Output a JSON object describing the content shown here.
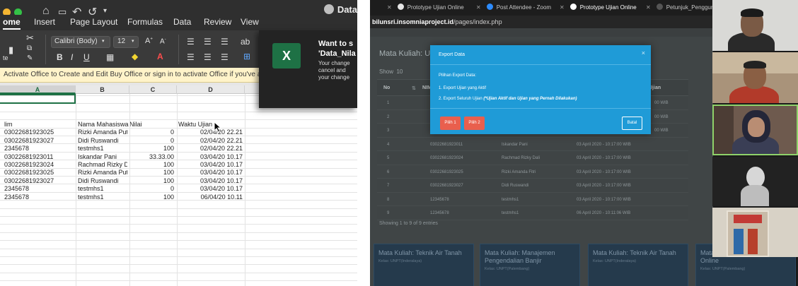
{
  "excel": {
    "document_name": "Data",
    "ribbon_tabs": [
      "ome",
      "Insert",
      "Page Layout",
      "Formulas",
      "Data",
      "Review",
      "View"
    ],
    "active_tab": "ome",
    "font_name": "Calibri (Body)",
    "font_size": "12",
    "notice": "Activate Office to Create and Edit   Buy Office or sign in to activate Office if you've already",
    "columns": [
      "A",
      "B",
      "C",
      "D"
    ],
    "header_row": {
      "a": "lim",
      "b": "Nama Mahasiswa",
      "c": "Nilai",
      "d": "Waktu Ujian"
    },
    "rows": [
      {
        "a": "03022681923025",
        "b": "Rizki Amanda Putri",
        "c": "0",
        "d": "02/04/20 22.21"
      },
      {
        "a": "03022681923027",
        "b": "Didi Ruswandi",
        "c": "0",
        "d": "02/04/20 22.21"
      },
      {
        "a": "2345678",
        "b": "testmhs1",
        "c": "100",
        "d": "02/04/20 22.21"
      },
      {
        "a": "03022681923011",
        "b": "Iskandar Pani",
        "c": "33.33.00",
        "d": "03/04/20 10.17"
      },
      {
        "a": "03022681923024",
        "b": "Rachmad Rizky Dali",
        "c": "100",
        "d": "03/04/20 10.17"
      },
      {
        "a": "03022681923025",
        "b": "Rizki Amanda Putri",
        "c": "100",
        "d": "03/04/20 10.17"
      },
      {
        "a": "03022681923027",
        "b": "Didi Ruswandi",
        "c": "100",
        "d": "03/04/20 10.17"
      },
      {
        "a": "2345678",
        "b": "testmhs1",
        "c": "0",
        "d": "03/04/20 10.17"
      },
      {
        "a": "2345678",
        "b": "testmhs1",
        "c": "100",
        "d": "06/04/20 10.11"
      }
    ],
    "dialog": {
      "title_line1": "Want to s",
      "title_line2": "'Data_Nila",
      "text_line1": "Your change",
      "text_line2": "cancel and",
      "text_line3": "your change"
    },
    "colors": {
      "ribbon": "#3a3a3a",
      "excel_green": "#1e7145",
      "notice_bg": "#fff3c9"
    }
  },
  "browser": {
    "tabs": [
      {
        "label": "Prototype Ujian Online",
        "active": false
      },
      {
        "label": "Post Attendee - Zoom",
        "active": false
      },
      {
        "label": "Prototype Ujian Online",
        "active": true
      },
      {
        "label": "Petunjuk_Penggunaan",
        "active": false
      }
    ],
    "url_host": "bilunsri.insomniaproject.id",
    "url_path": "/pages/index.php",
    "page": {
      "title": "Mata Kuliah: Uji Coba",
      "show_label": "Show",
      "show_value": "10",
      "table_headers": [
        "No",
        "NIM",
        "Ujian"
      ],
      "rows": [
        {
          "no": "1",
          "nim": "03022681923025",
          "name": "",
          "date": "00 WIB"
        },
        {
          "no": "2",
          "nim": "03022681923027",
          "name": "",
          "date": "00 WIB"
        },
        {
          "no": "3",
          "nim": "12345678",
          "name": "",
          "date": "00 WIB"
        },
        {
          "no": "4",
          "nim": "03022681923011",
          "name": "Iskandar Pani",
          "date": "03 April 2020 - 10:17:00 WIB"
        },
        {
          "no": "5",
          "nim": "03022681923024",
          "name": "Rachmad Rizky Dali",
          "date": "03 April 2020 - 10:17:00 WIB"
        },
        {
          "no": "6",
          "nim": "03022681923025",
          "name": "Rizki Amanda Fitri",
          "date": "03 April 2020 - 10:17:00 WIB"
        },
        {
          "no": "7",
          "nim": "03022681923027",
          "name": "Didi Ruswandi",
          "date": "03 April 2020 - 10:17:00 WIB"
        },
        {
          "no": "8",
          "nim": "12345678",
          "name": "testmhs1",
          "date": "03 April 2020 - 10:17:00 WIB"
        },
        {
          "no": "9",
          "nim": "12345678",
          "name": "testmhs1",
          "date": "06 April 2020 - 10:11:06 WIB"
        }
      ],
      "footer": "Showing 1 to 9 of 9 entries",
      "cards": [
        {
          "title": "Mata Kuliah: Teknik Air Tanah",
          "sub": "Kelas: UNPT(Inderalaya)"
        },
        {
          "title": "Mata Kuliah: Manajemen Pengendalian Banjir",
          "sub": "Kelas: UNPT(Palembang)"
        },
        {
          "title": "Mata Kuliah: Teknik Air Tanah",
          "sub": "Kelas: UNPT(Inderalaya)"
        },
        {
          "title": "Mata Kuliah: Uji Coba Ujian Online",
          "sub": "Kelas: UNPT(Palembang)"
        }
      ]
    },
    "modal": {
      "title": "Export Data",
      "intro": "Pilihan Export Data:",
      "option1": "1. Export Ujian yang Aktif",
      "option2_prefix": "2. Export Seluruh Ujian ",
      "option2_note": "(*Ujian Aktif dan Ujian yang Pernah Dilakukan)",
      "btn1": "Pilih 1",
      "btn2": "Pilih 2",
      "cancel": "Batal"
    },
    "colors": {
      "modal": "#1f9bd7",
      "button_red": "#e95f4d",
      "card": "#253a4c"
    }
  }
}
